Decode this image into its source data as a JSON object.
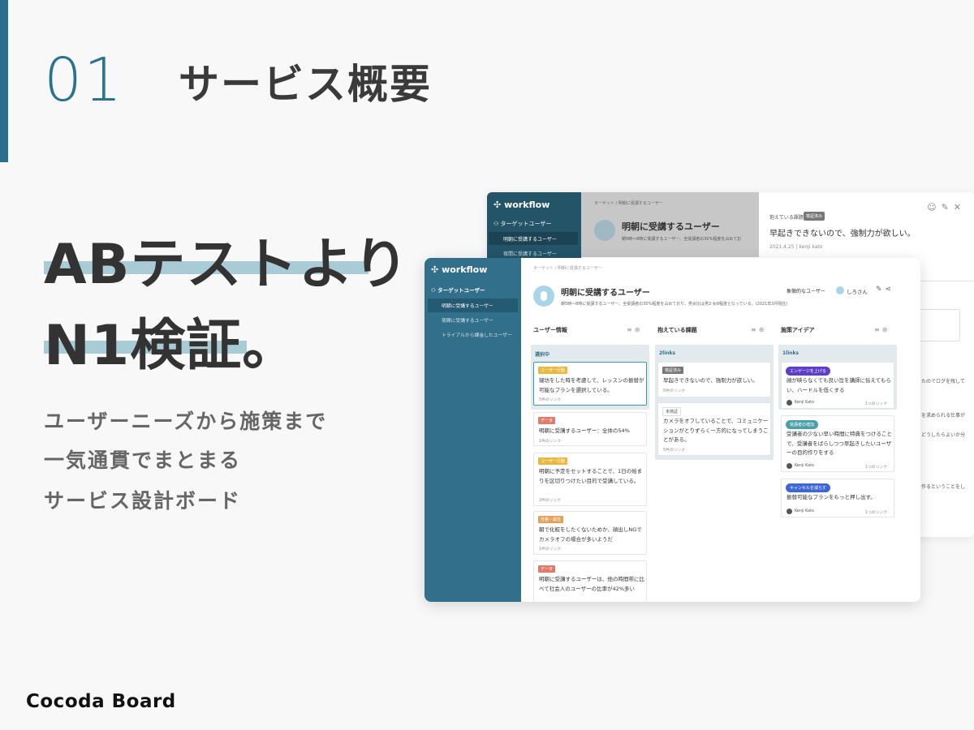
{
  "section": {
    "number": "01",
    "title": "サービス概要"
  },
  "headline": {
    "line1": "ABテストより",
    "line2": "N1検証。"
  },
  "subtext": {
    "line1": "ユーザーニーズから施策まで",
    "line2": "一気通貫でまとまる",
    "line3": "サービス設計ボード"
  },
  "brand": "Cocoda Board",
  "back_window": {
    "app_name": "workflow",
    "sidebar_heading": "ターゲットユーザー",
    "sidebar_items": [
      "明朝に受講するユーザー",
      "夜間に受講するユーザー"
    ],
    "breadcrumb": "ターゲット / 明朝に受講するユーザー",
    "title": "明朝に受講するユーザー",
    "description": "朝5時〜8時に受講するユーザー。全受講者の30%程度を占めてお",
    "panel": {
      "label": "抱えている課題",
      "badge": "検証済み",
      "issue": "早起きできないので、強制力が欲しい。",
      "date": "2021.4.25 | kenji kato"
    },
    "fragments": [
      "たのでログを残して",
      "を求められる仕事が",
      "どうしたらよいか分",
      "作るということをし"
    ]
  },
  "front_window": {
    "app_name": "workflow",
    "sidebar_heading": "ターゲットユーザー",
    "sidebar_items": [
      {
        "label": "明朝に受講するユーザー"
      },
      {
        "label": "夜間に受講するユーザー"
      },
      {
        "label": "トライアルから課金したユーザー"
      }
    ],
    "breadcrumb": "ターゲット / 明朝に受講するユーザー",
    "title": "明朝に受講するユーザー",
    "description": "朝5時〜8時に受講するユーザー。全受講者の30%程度を占めており、男女比は男2:女8程度となっている。(2021年3月現在)",
    "persona_label": "象徴的なユーザー",
    "persona_name": "しろさん",
    "columns": [
      {
        "header": "ユーザー情報",
        "count": "選択中",
        "cards": [
          {
            "tag": "ユーザー行動",
            "text": "寝坊をした時を考慮して、レッスンの振替が可能なプランを選択している。",
            "links": "5件のリンク"
          },
          {
            "tag": "データ",
            "text": "明朝に受講するユーザー：全体の54%",
            "links": "1件のリンク"
          },
          {
            "tag": "ユーザー行動",
            "text": "明朝に予定をセットすることで、1日の始まりを区切りつけたい目的で受講している。",
            "links": "2件のリンク"
          },
          {
            "tag": "性格・属性",
            "text": "朝で化粧をしたくないためか、顔出しNGでカメラオフの場合が多いようだ",
            "links": "1件のリンク"
          },
          {
            "tag": "データ",
            "text": "明朝に受講するユーザーは、他の時間帯に比べて社会人のユーザーの比率が42%多い",
            "links": ""
          }
        ]
      },
      {
        "header": "抱えている課題",
        "count": "2links",
        "cards": [
          {
            "tag": "検証済み",
            "text": "早起きできないので、強制力が欲しい。",
            "links": "5件のリンク"
          },
          {
            "tag": "未検証",
            "text": "カメラをオフしていることで、コミュニケーションがとりずらく一方的になってしまうことがある。",
            "links": "5件のリンク"
          }
        ]
      },
      {
        "header": "施策アイデア",
        "count": "1links",
        "cards": [
          {
            "tag": "エンゲージを上げる",
            "text": "顔が映らなくても良い旨を講師に伝えてもらい、ハードルを低くする",
            "author": "Kenji Kato",
            "links": "1つのリンク"
          },
          {
            "tag": "受講者の増加",
            "text": "受講者の少ない早い時間に特典をつけることで、受講者をばらしつつ早起きしたいユーザーの目的作りをする",
            "author": "Kenji Kato",
            "links": "1つのリンク"
          },
          {
            "tag": "キャンセルを減らす",
            "text": "振替可能なプランをもっと押し出す。",
            "author": "Kenji Kato",
            "links": "1つのリンク"
          }
        ]
      }
    ]
  },
  "colors": {
    "accent": "#2c6f8a",
    "highlight_underline": "#a9cbd6",
    "sidebar": "#316f8a",
    "tag_user_behavior": "#e9b83f",
    "tag_data": "#e07b6c",
    "tag_attribute": "#e3a05a",
    "tag_verified": "#777777",
    "tag_engage": "#5c3ec8",
    "tag_increase": "#4aa0a8",
    "tag_cancel": "#3f67d6"
  }
}
